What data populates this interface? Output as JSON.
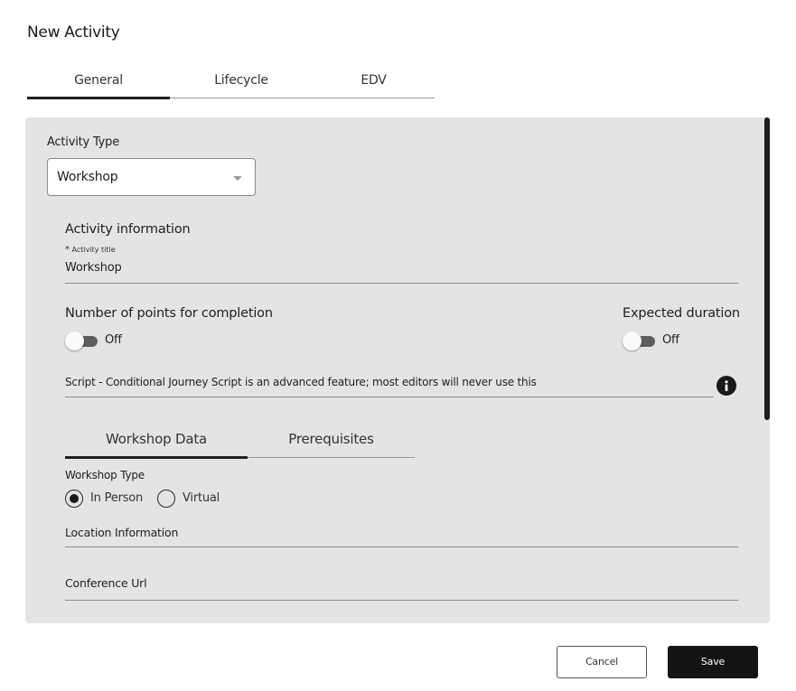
{
  "dialog": {
    "title": "New Activity"
  },
  "tabs": [
    {
      "label": "General",
      "active": true
    },
    {
      "label": "Lifecycle",
      "active": false
    },
    {
      "label": "EDV",
      "active": false
    }
  ],
  "activity_type": {
    "label": "Activity Type",
    "value": "Workshop",
    "icon": "chevron-down-icon"
  },
  "activity_info": {
    "section_title": "Activity information",
    "title_label": "Activity title",
    "required_mark": "*",
    "title_value": "Workshop"
  },
  "points": {
    "label": "Number of points for completion",
    "toggle_text": "Off",
    "enabled": false
  },
  "duration": {
    "label": "Expected duration",
    "toggle_text": "Off",
    "enabled": false
  },
  "script": {
    "placeholder": "Script - Conditional Journey Script is an advanced feature; most editors will never use this",
    "icon": "info-icon"
  },
  "sub_tabs": [
    {
      "label": "Workshop Data",
      "active": true
    },
    {
      "label": "Prerequisites",
      "active": false
    }
  ],
  "workshop": {
    "type_label": "Workshop Type",
    "options": [
      {
        "label": "In Person",
        "checked": true
      },
      {
        "label": "Virtual",
        "checked": false
      }
    ],
    "location_placeholder": "Location Information",
    "conference_placeholder": "Conference Url"
  },
  "actions": {
    "cancel_label": "Cancel",
    "save_label": "Save"
  },
  "colors": {
    "panel_bg": "#e4e4e4",
    "primary_button": "#141414",
    "toggle_track": "#5e5e5e"
  }
}
